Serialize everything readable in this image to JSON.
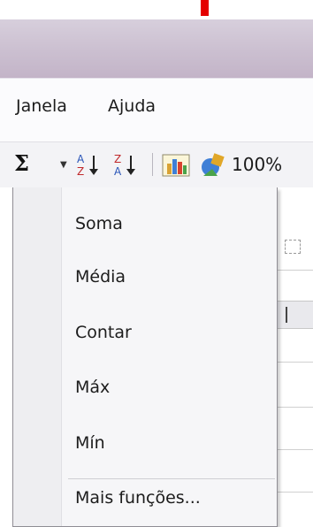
{
  "menu": {
    "janela": "Janela",
    "ajuda": "Ajuda"
  },
  "toolbar": {
    "autosum_symbol": "Σ",
    "autosum_arrow": "▼",
    "sort_ascending_icon": "sort-az-icon",
    "sort_descending_icon": "sort-za-icon",
    "chart_icon": "chart-wizard-icon",
    "drawing_icon": "drawing-icon",
    "zoom": "100%"
  },
  "autosum_menu": {
    "items": [
      {
        "label": "Soma"
      },
      {
        "label": "Média"
      },
      {
        "label": "Contar"
      },
      {
        "label": "Máx"
      },
      {
        "label": "Mín"
      },
      {
        "label": "Mais funções..."
      }
    ]
  },
  "colors": {
    "title_bar": "#cbbfd0",
    "marker": "#e40000",
    "menu_bg": "#f6f6f8",
    "menu_border": "#8f8d94"
  }
}
